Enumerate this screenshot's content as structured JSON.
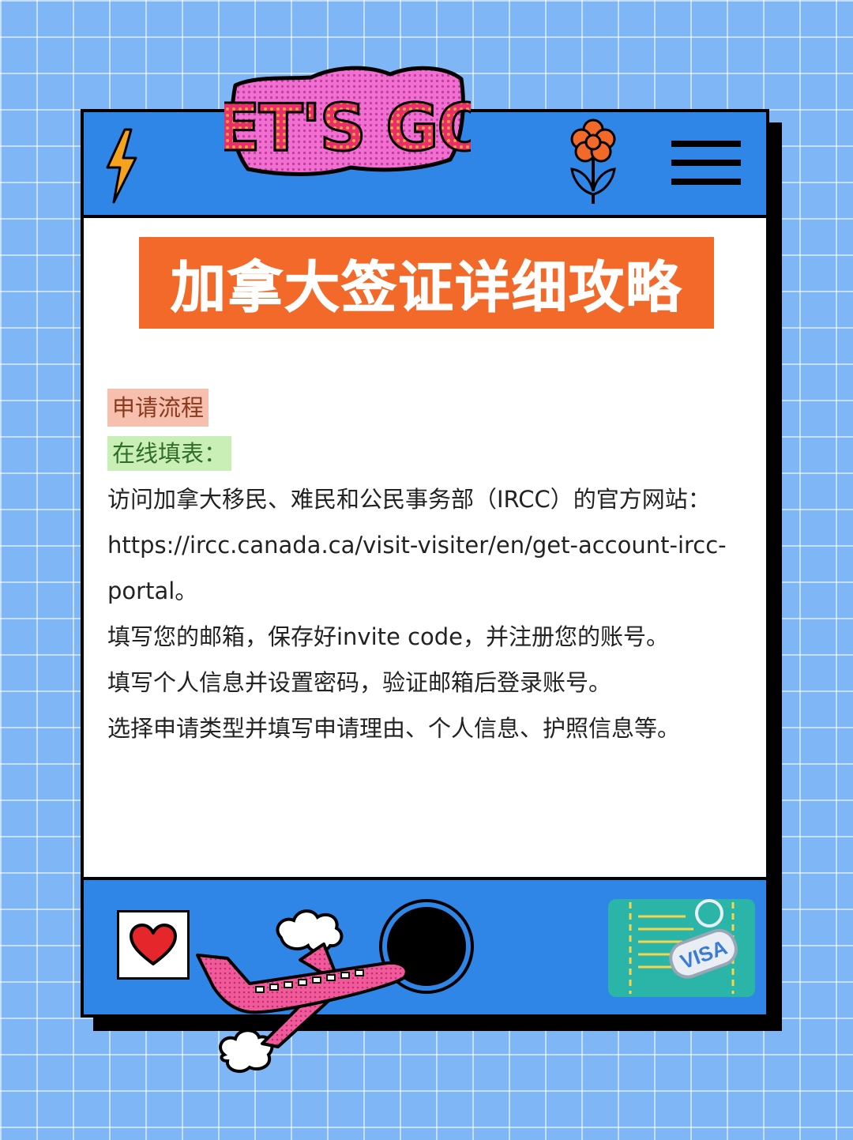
{
  "header": {
    "sticker_text": "LET'S GO!",
    "icons": [
      "lightning-icon",
      "flower-icon",
      "menu-icon"
    ]
  },
  "title": "加拿大签证详细攻略",
  "content": {
    "section_label": "申请流程",
    "subsection_label": "在线填表：",
    "paragraphs": [
      "访问加拿大移民、难民和公民事务部（IRCC）的官方网站：https://ircc.canada.ca/visit-visiter/en/get-account-ircc-portal。",
      "填写您的邮箱，保存好invite code，并注册您的账号。",
      "填写个人信息并设置密码，验证邮箱后登录账号。",
      "选择申请类型并填写申请理由、个人信息、护照信息等。"
    ]
  },
  "footer": {
    "visa_label": "VISA",
    "icons": [
      "heart-icon",
      "airplane-icon",
      "porthole-icon",
      "visa-card-icon"
    ]
  },
  "colors": {
    "background": "#7fb6f5",
    "bar_blue": "#2f86e6",
    "title_orange": "#f2692a",
    "tag_pink": "#f7bfae",
    "tag_green": "#c9efb7"
  }
}
